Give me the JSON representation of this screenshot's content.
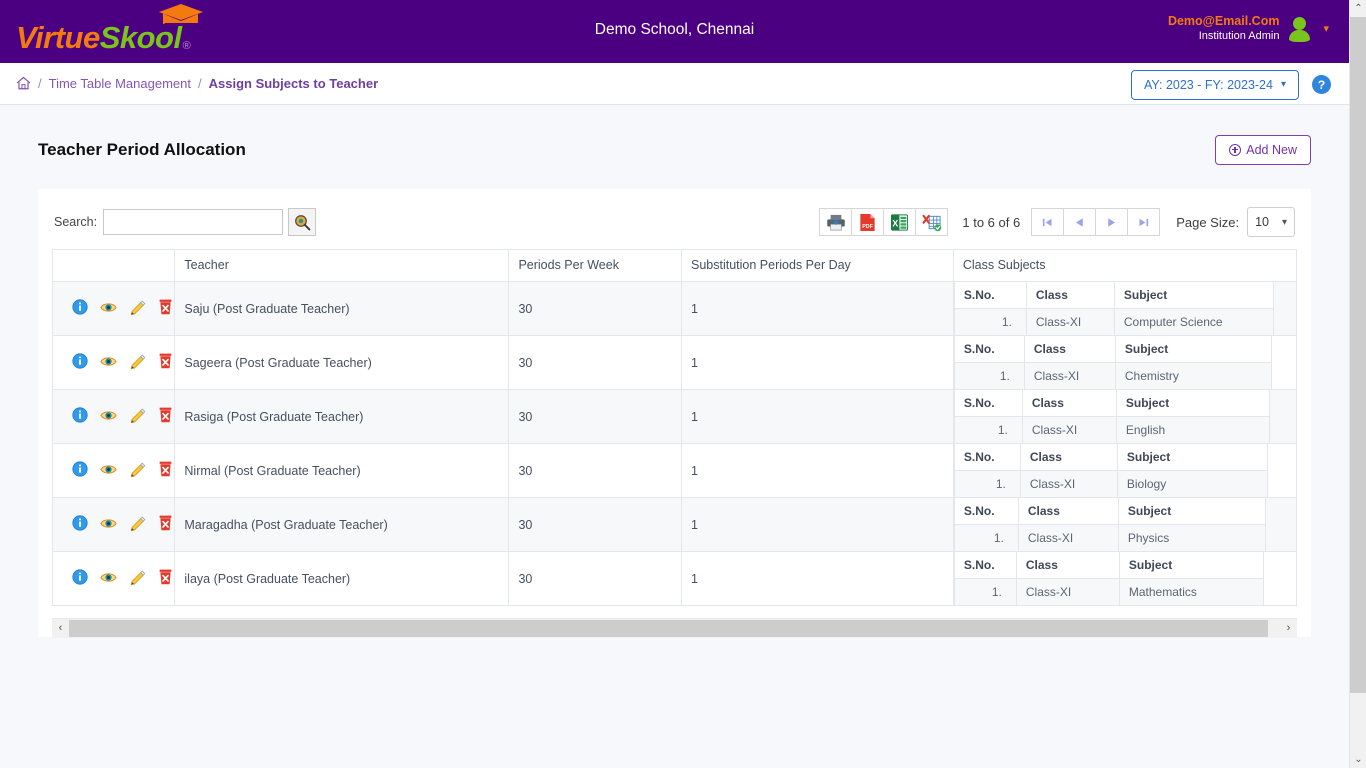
{
  "header": {
    "logo_virtue": "Virtue",
    "logo_skool": "Skool",
    "logo_reg": "®",
    "school_name": "Demo School, Chennai",
    "user_email": "Demo@Email.Com",
    "user_role": "Institution Admin",
    "brand_purple": "#4b0082",
    "brand_orange": "#f47a10",
    "brand_green": "#7ac41b"
  },
  "breadcrumb": {
    "home_icon": "home-icon",
    "sep": "/",
    "items": [
      {
        "label": "Time Table Management",
        "current": false
      },
      {
        "label": "Assign Subjects to Teacher",
        "current": true
      }
    ],
    "academic_year": "AY: 2023 - FY: 2023-24",
    "help_label": "?"
  },
  "page": {
    "title": "Teacher Period Allocation",
    "add_new_label": "Add New"
  },
  "grid_toolbar": {
    "search_label": "Search:",
    "search_value": "",
    "search_placeholder": "",
    "search_icon": "magnifier-icon",
    "export_buttons": [
      {
        "name": "print-button",
        "icon": "printer-icon",
        "title": "Print"
      },
      {
        "name": "pdf-export-button",
        "icon": "pdf-icon",
        "title": "PDF",
        "label": "PDF"
      },
      {
        "name": "excel-export-button",
        "icon": "excel-icon",
        "title": "Excel",
        "label": "X"
      },
      {
        "name": "csv-export-button",
        "icon": "csv-icon",
        "title": "CSV"
      }
    ],
    "record_count": "1 to 6 of 6",
    "pager_buttons": [
      {
        "name": "first-page-button",
        "glyph": "first"
      },
      {
        "name": "previous-page-button",
        "glyph": "prev"
      },
      {
        "name": "next-page-button",
        "glyph": "next"
      },
      {
        "name": "last-page-button",
        "glyph": "last"
      }
    ],
    "page_size_label": "Page Size:",
    "page_size_value": "10"
  },
  "table": {
    "columns": [
      "",
      "Teacher",
      "Periods Per Week",
      "Substitution Periods Per Day",
      "Class Subjects"
    ],
    "row_action_icons": [
      "info-icon",
      "view-icon",
      "edit-icon",
      "delete-icon"
    ],
    "sub_columns": [
      "S.No.",
      "Class",
      "Subject"
    ],
    "rows": [
      {
        "teacher": "Saju (Post Graduate Teacher)",
        "periods_per_week": "30",
        "substitution_periods_per_day": "1",
        "subjects": [
          {
            "sno": "1.",
            "class": "Class-XI",
            "subject": "Computer Science"
          }
        ]
      },
      {
        "teacher": "Sageera (Post Graduate Teacher)",
        "periods_per_week": "30",
        "substitution_periods_per_day": "1",
        "subjects": [
          {
            "sno": "1.",
            "class": "Class-XI",
            "subject": "Chemistry"
          }
        ]
      },
      {
        "teacher": "Rasiga (Post Graduate Teacher)",
        "periods_per_week": "30",
        "substitution_periods_per_day": "1",
        "subjects": [
          {
            "sno": "1.",
            "class": "Class-XI",
            "subject": "English"
          }
        ]
      },
      {
        "teacher": "Nirmal (Post Graduate Teacher)",
        "periods_per_week": "30",
        "substitution_periods_per_day": "1",
        "subjects": [
          {
            "sno": "1.",
            "class": "Class-XI",
            "subject": "Biology"
          }
        ]
      },
      {
        "teacher": "Maragadha (Post Graduate Teacher)",
        "periods_per_week": "30",
        "substitution_periods_per_day": "1",
        "subjects": [
          {
            "sno": "1.",
            "class": "Class-XI",
            "subject": "Physics"
          }
        ]
      },
      {
        "teacher": "ilaya (Post Graduate Teacher)",
        "periods_per_week": "30",
        "substitution_periods_per_day": "1",
        "subjects": [
          {
            "sno": "1.",
            "class": "Class-XI",
            "subject": "Mathematics"
          }
        ]
      }
    ]
  },
  "scrollbars": {
    "h_left_glyph": "‹",
    "h_right_glyph": "›",
    "v_up_glyph": "⌃",
    "v_down_glyph": "⌄"
  }
}
